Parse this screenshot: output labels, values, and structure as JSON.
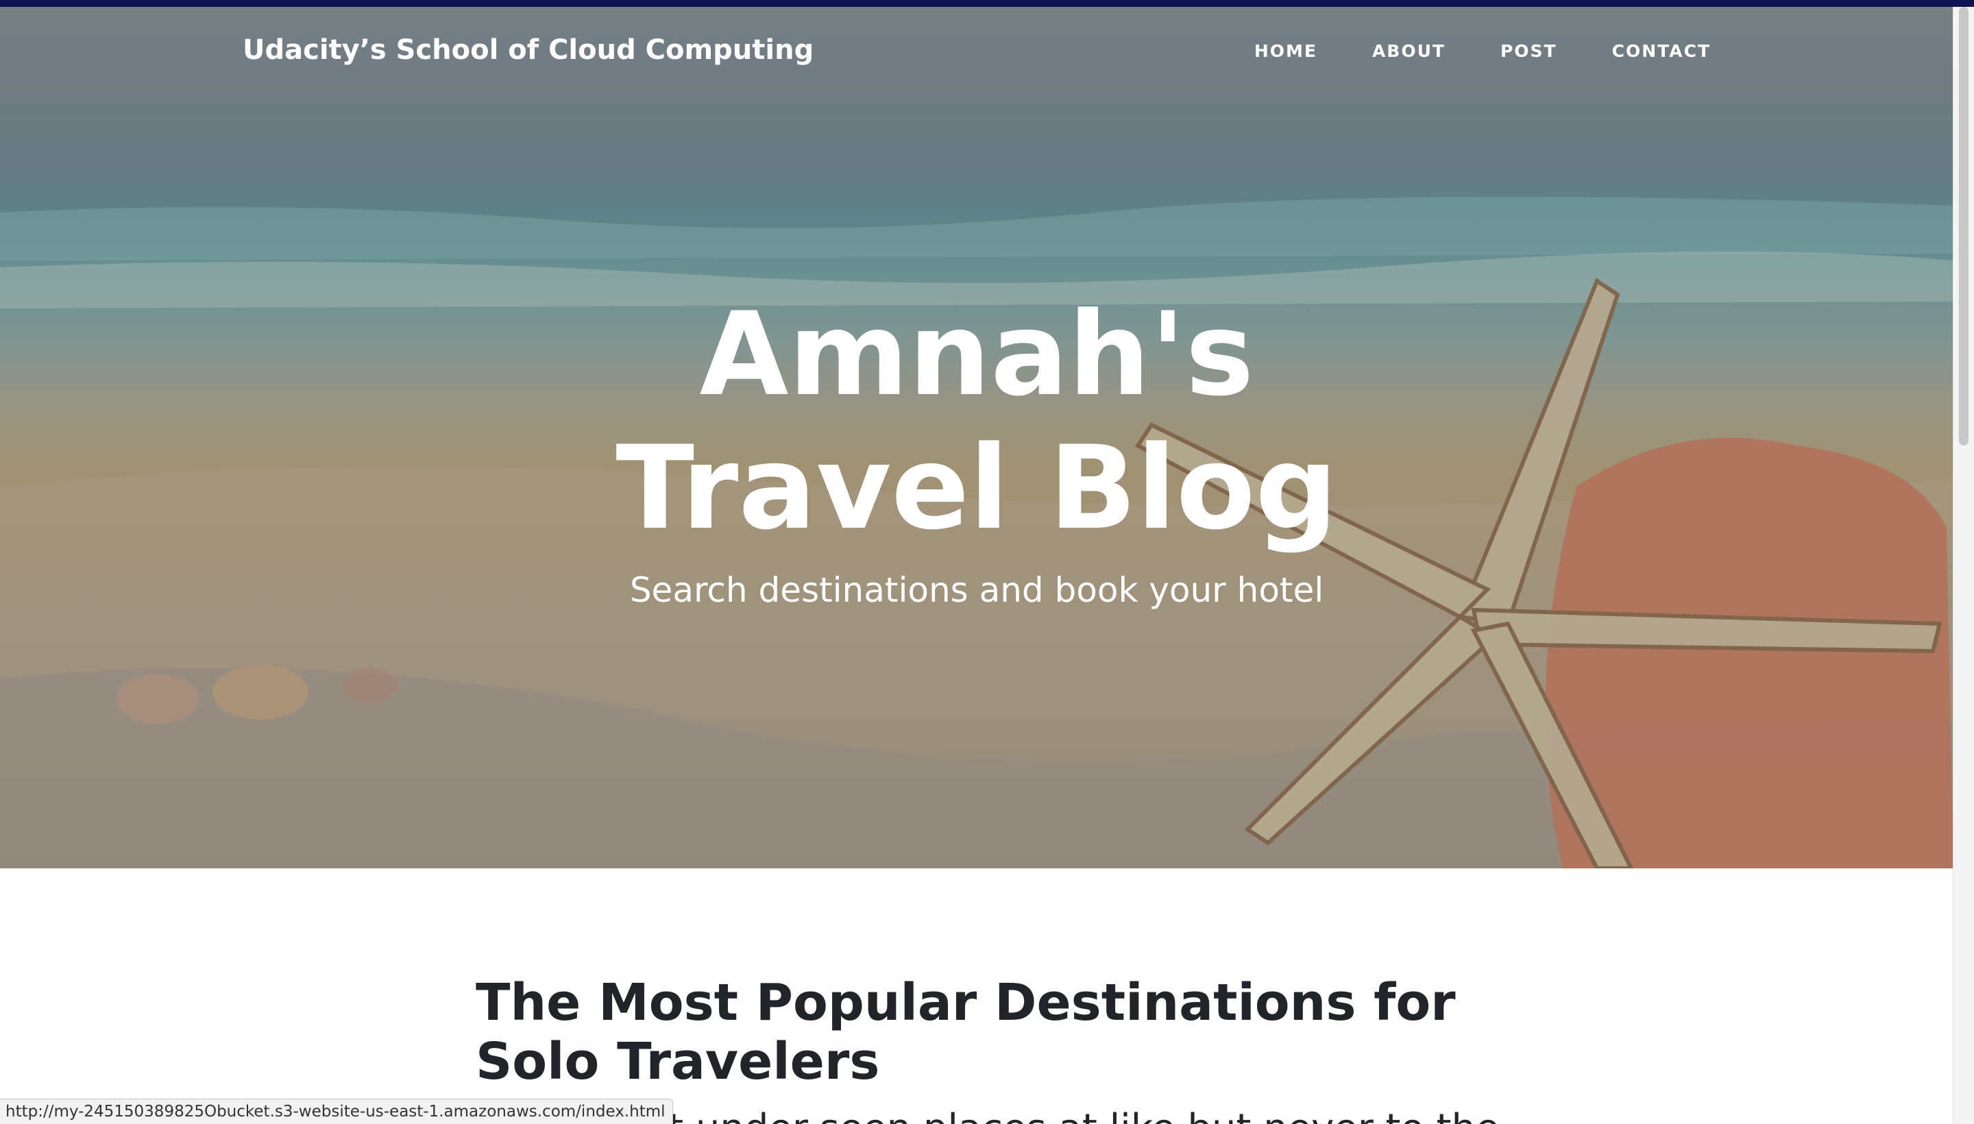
{
  "nav": {
    "brand": "Udacity’s School of Cloud Computing",
    "links": [
      "HOME",
      "ABOUT",
      "POST",
      "CONTACT"
    ]
  },
  "hero": {
    "title": "Amnah's Travel Blog",
    "subtitle": "Search destinations and book your hotel"
  },
  "post": {
    "title": "The Most Popular Destinations for Solo Travelers",
    "subtitle_partial": "...the most under-seen places at like but never to the"
  },
  "status_bar": {
    "url": "http://my-245150389825Obucket.s3-website-us-east-1.amazonaws.com/index.html"
  },
  "colors": {
    "top_stripe": "#0d1450",
    "nav_text": "#ffffff",
    "heading_text": "#212529"
  }
}
